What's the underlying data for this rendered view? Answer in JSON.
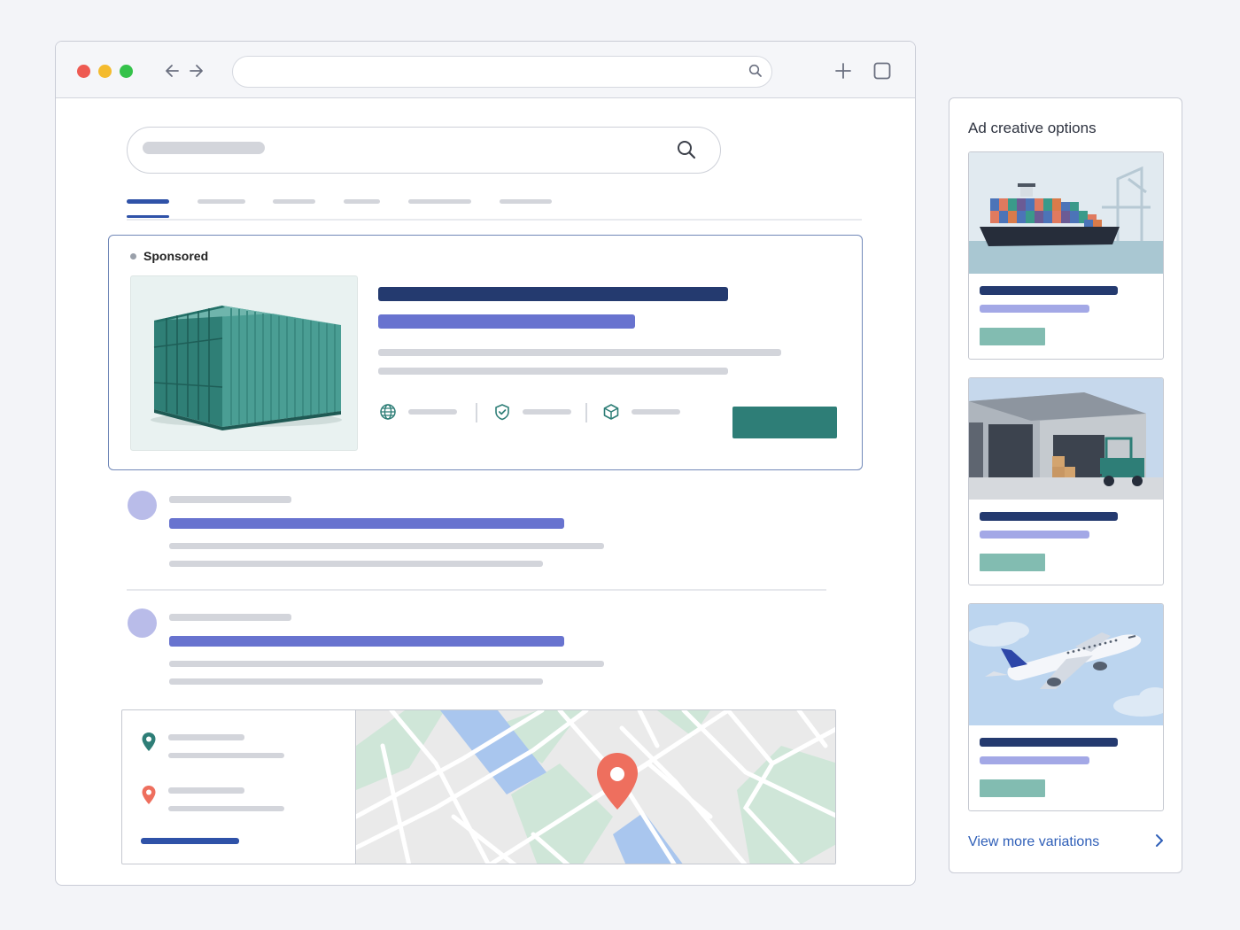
{
  "ad": {
    "sponsored_label": "Sponsored"
  },
  "side_panel": {
    "title": "Ad creative options",
    "variations": [
      {
        "image": "cargo-ship"
      },
      {
        "image": "warehouse-forklift"
      },
      {
        "image": "airplane"
      }
    ],
    "view_more": "View more variations"
  },
  "colors": {
    "accent_navy": "#243a6f",
    "accent_periwinkle": "#6873cf",
    "teal_cta": "#2e7e77",
    "map_pin_red": "#ee6f5e"
  }
}
